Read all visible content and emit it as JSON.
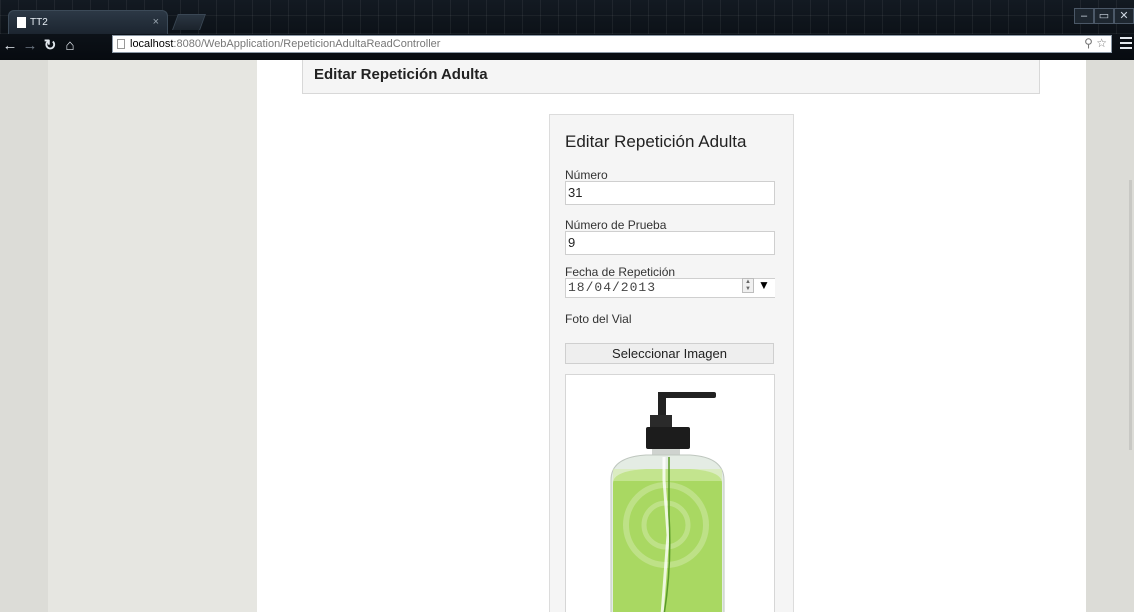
{
  "browser": {
    "tab_title": "TT2",
    "tab_close": "×",
    "url_host": "localhost",
    "url_rest": ":8080/WebApplication/RepeticionAdultaReadController",
    "window_buttons": [
      "–",
      "▭",
      "✕"
    ]
  },
  "page": {
    "header_title": "Editar Repetición Adulta"
  },
  "form": {
    "title": "Editar Repetición Adulta",
    "numero_label": "Número",
    "numero_value": "31",
    "prueba_label": "Número de Prueba",
    "prueba_value": "9",
    "fecha_label": "Fecha de Repetición",
    "fecha_value": "18/04/2013",
    "foto_label": "Foto del Vial",
    "select_image_button": "Seleccionar Imagen"
  },
  "colors": {
    "bottle_liquid": "#a9d862",
    "bottle_pump": "#222222"
  }
}
